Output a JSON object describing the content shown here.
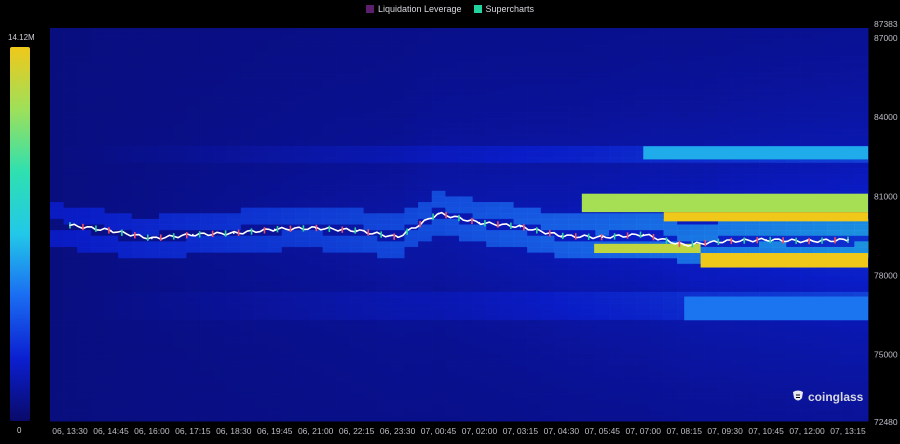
{
  "legend": [
    {
      "label": "Liquidation Leverage",
      "color": "#5b1f6e"
    },
    {
      "label": "Supercharts",
      "color": "#22d3a0"
    }
  ],
  "colorbar": {
    "max_label": "14.12M",
    "min_label": "0",
    "colors": [
      "#0a0a6a",
      "#0b1fd0",
      "#1a6cf2",
      "#22c8e8",
      "#2fe0b0",
      "#9ee05a",
      "#f0c81a"
    ]
  },
  "brand": {
    "name": "coinglass",
    "icon": "coinglass-logo-icon"
  },
  "chart_data": {
    "type": "heatmap",
    "title": "",
    "x_ticks": [
      "06, 13:30",
      "06, 14:45",
      "06, 16:00",
      "06, 17:15",
      "06, 18:30",
      "06, 19:45",
      "06, 21:00",
      "06, 22:15",
      "06, 23:30",
      "07, 00:45",
      "07, 02:00",
      "07, 03:15",
      "07, 04:30",
      "07, 05:45",
      "07, 07:00",
      "07, 08:15",
      "07, 09:30",
      "07, 10:45",
      "07, 12:00",
      "07, 13:15"
    ],
    "y_ticks": [
      "87383",
      "87000",
      "84000",
      "81000",
      "78000",
      "75000",
      "72480"
    ],
    "y_tick_values": [
      87383,
      87000,
      84000,
      81000,
      78000,
      75000,
      72480
    ],
    "ylim": [
      72480,
      87383
    ],
    "price_series": {
      "name": "",
      "x_index": [
        0,
        1,
        2,
        3,
        4,
        5,
        6,
        7,
        8,
        9,
        10,
        11,
        12,
        13,
        14,
        15,
        16,
        17,
        18,
        19
      ],
      "values": [
        79900,
        79700,
        79400,
        79550,
        79600,
        79750,
        79800,
        79700,
        79450,
        80350,
        80000,
        79850,
        79500,
        79450,
        79550,
        79150,
        79300,
        79350,
        79300,
        79350
      ]
    },
    "liquidation_bands": [
      {
        "low": 80400,
        "high": 81100,
        "start_index": 12.5,
        "end_index": 19.7,
        "level": 0.85
      },
      {
        "low": 80050,
        "high": 80400,
        "start_index": 14.5,
        "end_index": 19.7,
        "level": 1.0
      },
      {
        "low": 78300,
        "high": 78850,
        "start_index": 15.4,
        "end_index": 19.7,
        "level": 1.0
      },
      {
        "low": 78850,
        "high": 79200,
        "start_index": 12.8,
        "end_index": 15.4,
        "level": 0.9
      },
      {
        "low": 82400,
        "high": 82900,
        "start_index": 14.0,
        "end_index": 19.7,
        "level": 0.45
      },
      {
        "low": 76300,
        "high": 77200,
        "start_index": 15.0,
        "end_index": 19.7,
        "level": 0.35
      }
    ]
  }
}
